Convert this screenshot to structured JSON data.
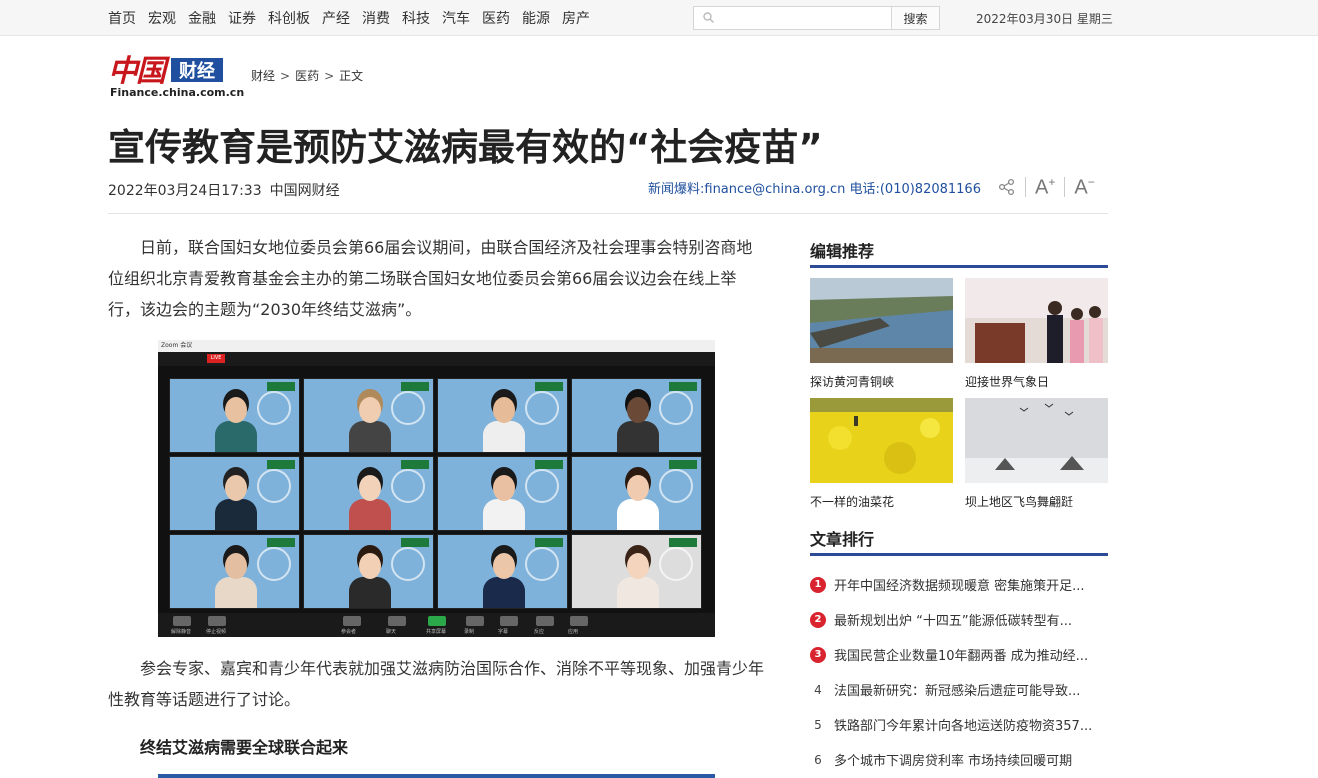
{
  "topnav": {
    "items": [
      "首页",
      "宏观",
      "金融",
      "证券",
      "科创板",
      "产经",
      "消费",
      "科技",
      "汽车",
      "医药",
      "能源",
      "房产"
    ],
    "search_placeholder": "",
    "search_button": "搜索",
    "date": "2022年03月30日 星期三"
  },
  "logo": {
    "mark": "中国",
    "box": "财经",
    "url": "Finance.china.com.cn"
  },
  "breadcrumb": [
    "财经",
    "医药",
    "正文"
  ],
  "article": {
    "title": "宣传教育是预防艾滋病最有效的“社会疫苗”",
    "datetime": "2022年03月24日17:33",
    "source": "中国网财经",
    "contact": "新闻爆料:finance@china.org.cn 电话:(010)82081166",
    "paragraph1": "日前，联合国妇女地位委员会第66届会议期间，由联合国经济及社会理事会特别咨商地位组织北京青爱教育基金会主办的第二场联合国妇女地位委员会第66届会议边会在线上举行，该边会的主题为“2030年终结艾滋病”。",
    "paragraph2": "参会专家、嘉宾和青少年代表就加强艾滋病防治国际合作、消除不平等现象、加强青少年性教育等话题进行了讨论。",
    "subhead": "终结艾滋病需要全球联合起来",
    "zoom": {
      "title": "Zoom 会议",
      "live": "LIVE",
      "bottom_labels": [
        "解除静音",
        "停止视频",
        "参会者",
        "聊天",
        "共享屏幕",
        "录制",
        "字幕",
        "反应",
        "应用"
      ]
    }
  },
  "sidebar": {
    "editor_title": "编辑推荐",
    "picks": [
      {
        "caption": "探访黄河青铜峡"
      },
      {
        "caption": "迎接世界气象日"
      },
      {
        "caption": "不一样的油菜花"
      },
      {
        "caption": "坝上地区飞鸟舞翩跹"
      }
    ],
    "rank_title": "文章排行",
    "ranks": [
      {
        "num": "1",
        "text": "开年中国经济数据频现暖意 密集施策开足..."
      },
      {
        "num": "2",
        "text": "最新规划出炉 “十四五”能源低碳转型有..."
      },
      {
        "num": "3",
        "text": "我国民营企业数量10年翻两番 成为推动经..."
      },
      {
        "num": "4",
        "text": "法国最新研究：新冠感染后遗症可能导致..."
      },
      {
        "num": "5",
        "text": "铁路部门今年累计向各地运送防疫物资357..."
      },
      {
        "num": "6",
        "text": "多个城市下调房贷利率 市场持续回暖可期"
      }
    ]
  },
  "colors": {
    "brand_red": "#c8161d",
    "brand_blue": "#1f4f9e",
    "rank_red": "#d9232e",
    "side_line": "#2c4a95"
  }
}
